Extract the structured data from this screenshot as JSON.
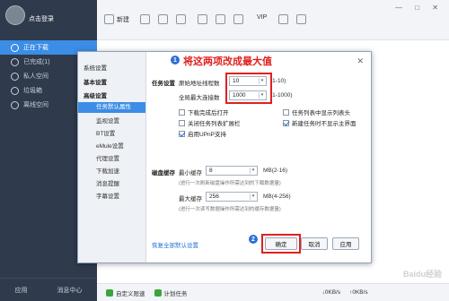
{
  "sidebar": {
    "login_text": "点击登录",
    "items": [
      {
        "label": "正在下载"
      },
      {
        "label": "已完成(1)"
      },
      {
        "label": "私人空间"
      },
      {
        "label": "垃圾箱"
      },
      {
        "label": "离线空间"
      }
    ],
    "bottom": {
      "apps": "应用",
      "messages": "消息中心"
    }
  },
  "toolbar": {
    "new_label": "新建",
    "vip_label": "VIP"
  },
  "statusbar": {
    "custom_speed": "自定义限速",
    "plan_task": "计划任务",
    "down_speed": "0KB/s",
    "up_speed": "0KB/s"
  },
  "dialog": {
    "categories": {
      "system_settings": "系统设置",
      "basic_settings": "基本设置",
      "advanced_settings": "高级设置",
      "task_defaults": "任务默认属性",
      "monitor": "监视设置",
      "bt": "BT设置",
      "emule": "eMule设置",
      "proxy": "代理设置",
      "accel": "下载加速",
      "notify": "消息提醒",
      "subtitle": "字幕设置"
    },
    "task_settings_label": "任务设置",
    "orig_threads_label": "原始地址线程数",
    "orig_threads_value": "10",
    "orig_threads_range": "(1-10)",
    "max_conn_label": "全局最大连接数",
    "max_conn_value": "1000",
    "max_conn_range": "(1-1000)",
    "checkboxes": [
      {
        "label": "下载完成后打开",
        "checked": false
      },
      {
        "label": "任务列表中显示列表头",
        "checked": false
      },
      {
        "label": "关闭任务列表扩展栏",
        "checked": false
      },
      {
        "label": "新建任务时不显示主界面",
        "checked": true
      },
      {
        "label": "启用UPnP支持",
        "checked": true
      }
    ],
    "disk_cache_label": "磁盘缓存",
    "min_cache_label": "最小缓存",
    "min_cache_value": "8",
    "min_cache_range": "MB(2-16)",
    "min_cache_note": "(进行一次刷新磁盘操作所需达到的下载数据量)",
    "max_cache_label": "最大缓存",
    "max_cache_value": "256",
    "max_cache_range": "MB(4-256)",
    "max_cache_note": "(进行一次读写数据操作所需达到的缓存数据量)",
    "restore_link": "恢复全部默认设置",
    "ok_label": "确定",
    "cancel_label": "取消",
    "apply_label": "应用"
  },
  "annotations": {
    "badge1": "1",
    "badge2": "2",
    "note1": "将这两项改成最大值"
  },
  "watermark": "Baidu经验"
}
